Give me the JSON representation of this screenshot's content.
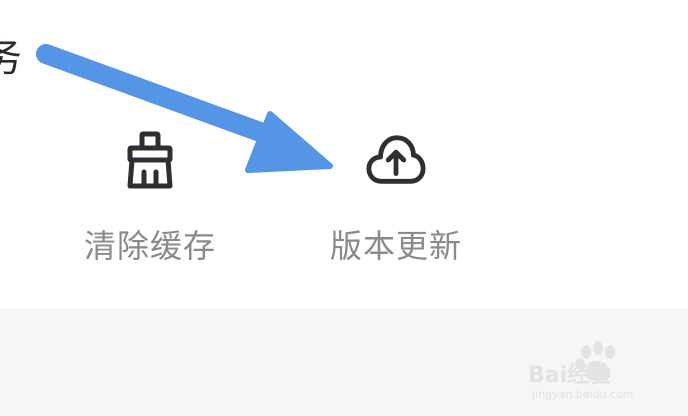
{
  "tools": [
    {
      "id": "clear-cache",
      "label": "清除缓存",
      "icon": "broom-icon"
    },
    {
      "id": "version-update",
      "label": "版本更新",
      "icon": "cloud-upload-icon"
    }
  ],
  "annotation": {
    "arrow_color": "#5495e6"
  },
  "colors": {
    "icon": "#2e2e33",
    "label": "#8a8a8e",
    "background": "#ffffff",
    "bottom_band": "#f6f6f6"
  },
  "watermark": {
    "text_main": "Bai经验",
    "text_sub": "jingyan.baidu.com"
  }
}
